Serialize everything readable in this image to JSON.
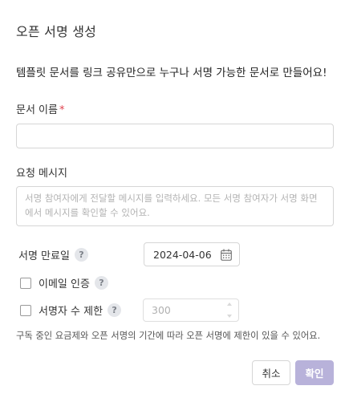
{
  "dialog": {
    "title": "오픈 서명 생성",
    "intro": "템플릿 문서를 링크 공유만으로 누구나 서명 가능한 문서로 만들어요!"
  },
  "doc_name": {
    "label": "문서 이름",
    "required_mark": "*",
    "value": "",
    "placeholder": ""
  },
  "message": {
    "label": "요청 메시지",
    "placeholder": "서명 참여자에게 전달할 메시지를 입력하세요. 모든 서명 참여자가 서명 화면에서 메시지를 확인할 수 있어요."
  },
  "expiry": {
    "label": "서명 만료일",
    "help": "?",
    "date": "2024-04-06",
    "icon": "calendar-icon"
  },
  "email_auth": {
    "label": "이메일 인증",
    "help": "?",
    "checked": false
  },
  "signer_limit": {
    "label": "서명자 수 제한",
    "help": "?",
    "checked": false,
    "value": "300"
  },
  "note": "구독 중인 요금제와 오픈 서명의 기간에 따라 오픈 서명에 제한이 있을 수 있어요.",
  "actions": {
    "cancel": "취소",
    "confirm": "확인"
  },
  "colors": {
    "required": "#e0424e",
    "confirm_button": "#b8b2da"
  }
}
